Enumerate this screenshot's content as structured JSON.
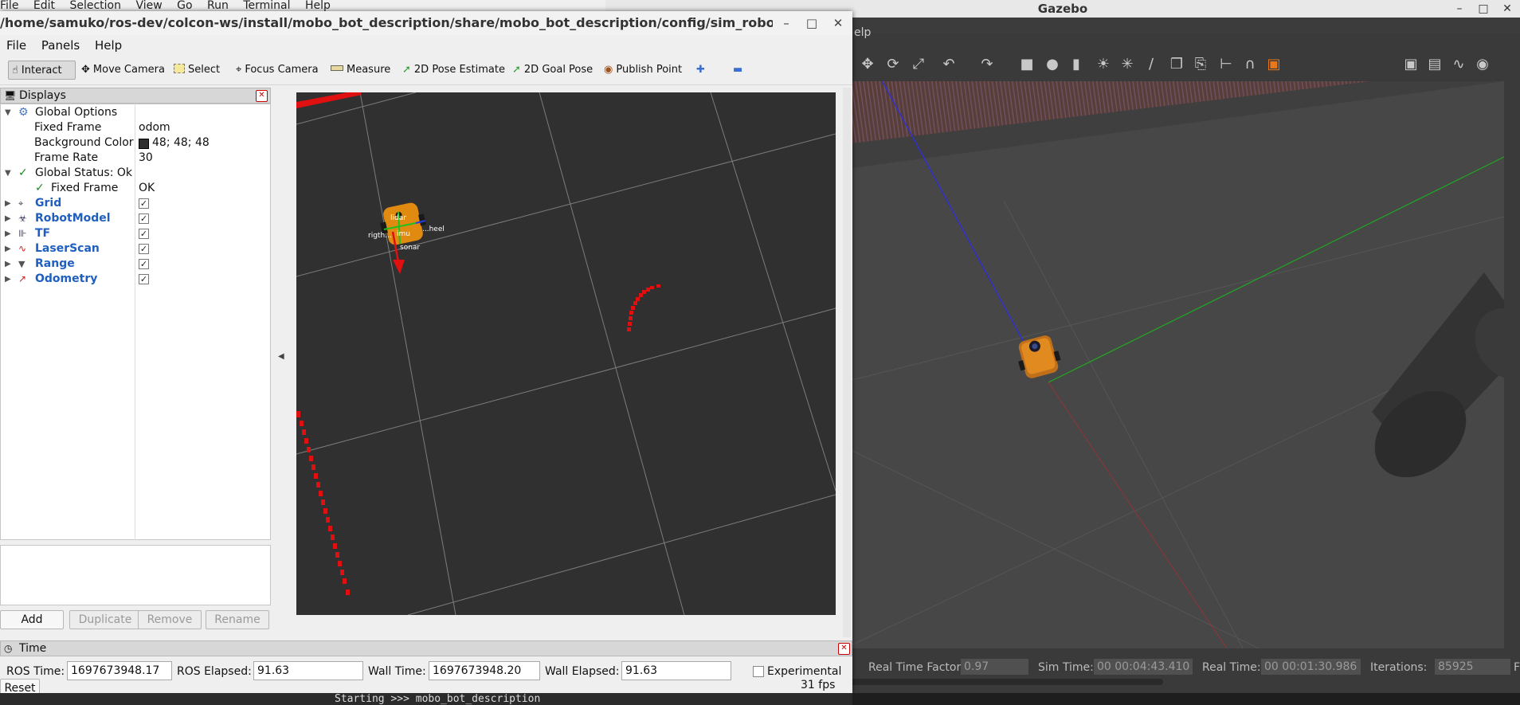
{
  "background": {
    "menu": [
      "File",
      "Edit",
      "Selection",
      "View",
      "Go",
      "Run",
      "Terminal",
      "Help"
    ],
    "terminal_text": "Starting >>> mobo_bot_description"
  },
  "gazebo": {
    "title": "Gazebo",
    "menu_partial": "elp",
    "status": {
      "real_time_factor_label": "Real Time Factor:",
      "real_time_factor": "0.97",
      "sim_time_label": "Sim Time:",
      "sim_time": "00 00:04:43.410",
      "real_time_label": "Real Time:",
      "real_time": "00 00:01:30.986",
      "iterations_label": "Iterations:",
      "iterations": "85925",
      "extra": "F"
    }
  },
  "rviz": {
    "title": "/home/samuko/ros-dev/colcon-ws/install/mobo_bot_description/share/mobo_bot_description/config/sim_robot_with_rviz.config.rviz* ...",
    "menu": {
      "file": "File",
      "panels": "Panels",
      "help": "Help"
    },
    "toolbar": {
      "interact": "Interact",
      "move_camera": "Move Camera",
      "select": "Select",
      "focus_camera": "Focus Camera",
      "measure": "Measure",
      "pose_estimate": "2D Pose Estimate",
      "goal_pose": "2D Goal Pose",
      "publish_point": "Publish Point"
    },
    "displays": {
      "title": "Displays",
      "global_options": "Global Options",
      "fixed_frame_label": "Fixed Frame",
      "fixed_frame_value": "odom",
      "bg_color_label": "Background Color",
      "bg_color_value": "48; 48; 48",
      "bg_color_swatch": "#303030",
      "frame_rate_label": "Frame Rate",
      "frame_rate_value": "30",
      "global_status": "Global Status: Ok",
      "status_fixed_frame": "Fixed Frame",
      "status_fixed_frame_value": "OK",
      "items": [
        "Grid",
        "RobotModel",
        "TF",
        "LaserScan",
        "Range",
        "Odometry"
      ]
    },
    "buttons": {
      "add": "Add",
      "duplicate": "Duplicate",
      "remove": "Remove",
      "rename": "Rename"
    },
    "view_labels": {
      "lidar": "lidar",
      "imu": "imu",
      "right": "rigth...",
      "wheel": "...heel",
      "sonar": "sonar"
    },
    "time": {
      "title": "Time",
      "ros_time_label": "ROS Time:",
      "ros_time": "1697673948.17",
      "ros_elapsed_label": "ROS Elapsed:",
      "ros_elapsed": "91.63",
      "wall_time_label": "Wall Time:",
      "wall_time": "1697673948.20",
      "wall_elapsed_label": "Wall Elapsed:",
      "wall_elapsed": "91.63",
      "experimental": "Experimental",
      "reset": "Reset",
      "fps": "31 fps"
    }
  }
}
